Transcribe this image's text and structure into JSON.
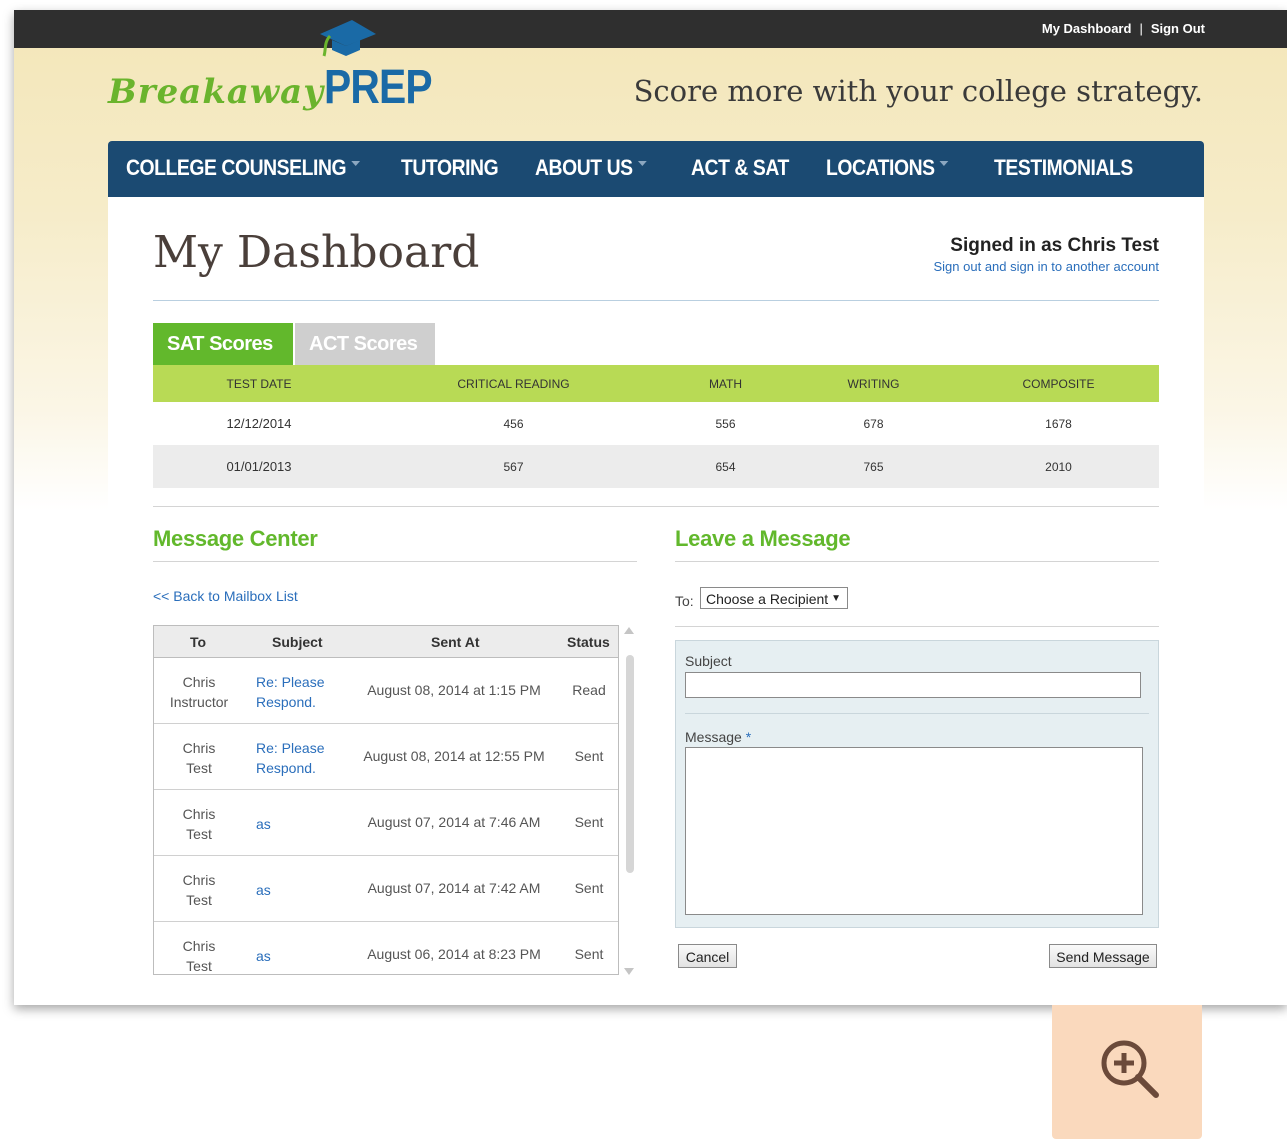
{
  "topbar": {
    "dashboard_link": "My Dashboard",
    "separator": "|",
    "signout_link": "Sign Out"
  },
  "brand": {
    "script_text": "Breakaway",
    "bold_text": "PREP",
    "tagline": "Score more with your college strategy."
  },
  "nav": {
    "items": [
      {
        "label": "COLLEGE COUNSELING",
        "has_dropdown": true
      },
      {
        "label": "TUTORING",
        "has_dropdown": false
      },
      {
        "label": "ABOUT US",
        "has_dropdown": true
      },
      {
        "label": "ACT & SAT",
        "has_dropdown": false
      },
      {
        "label": "LOCATIONS",
        "has_dropdown": true
      },
      {
        "label": "TESTIMONIALS",
        "has_dropdown": false
      }
    ]
  },
  "page": {
    "title": "My Dashboard",
    "signed_in": "Signed in as Chris Test",
    "switch_account": "Sign out and sign in to another account"
  },
  "scores": {
    "tabs": [
      "SAT Scores",
      "ACT Scores"
    ],
    "active_tab": "SAT Scores",
    "columns": [
      "TEST DATE",
      "CRITICAL READING",
      "MATH",
      "WRITING",
      "COMPOSITE"
    ],
    "rows": [
      [
        "12/12/2014",
        "456",
        "556",
        "678",
        "1678"
      ],
      [
        "01/01/2013",
        "567",
        "654",
        "765",
        "2010"
      ]
    ]
  },
  "message_center": {
    "title": "Message Center",
    "back_link": "<< Back to Mailbox List",
    "columns": [
      "To",
      "Subject",
      "Sent At",
      "Status"
    ],
    "rows": [
      {
        "to": [
          "Chris",
          "Instructor"
        ],
        "subject": [
          "Re: Please",
          "Respond."
        ],
        "sent": "August 08, 2014 at 1:15 PM",
        "status": "Read"
      },
      {
        "to": [
          "Chris",
          "Test"
        ],
        "subject": [
          "Re: Please",
          "Respond."
        ],
        "sent": "August 08, 2014 at 12:55 PM",
        "status": "Sent"
      },
      {
        "to": [
          "Chris",
          "Test"
        ],
        "subject": [
          "as"
        ],
        "sent": "August 07, 2014 at 7:46 AM",
        "status": "Sent"
      },
      {
        "to": [
          "Chris",
          "Test"
        ],
        "subject": [
          "as"
        ],
        "sent": "August 07, 2014 at 7:42 AM",
        "status": "Sent"
      },
      {
        "to": [
          "Chris",
          "Test"
        ],
        "subject": [
          "as"
        ],
        "sent": "August 06, 2014 at 8:23 PM",
        "status": "Sent"
      }
    ]
  },
  "leave_message": {
    "title": "Leave a Message",
    "to_label": "To:",
    "recipient_select": "Choose a Recipient",
    "select_arrow": "▼",
    "subject_label": "Subject",
    "subject_value": "",
    "message_label": "Message",
    "required_mark": "*",
    "message_value": "",
    "cancel_button": "Cancel",
    "send_button": "Send Message"
  },
  "colors": {
    "nav_bg": "#1b4a72",
    "accent_green": "#62b82c",
    "table_header": "#b8da55",
    "link_blue": "#2a6ebb",
    "zoom_bg": "#fad9bd"
  },
  "icons": {
    "zoom": "zoom-in-icon"
  }
}
